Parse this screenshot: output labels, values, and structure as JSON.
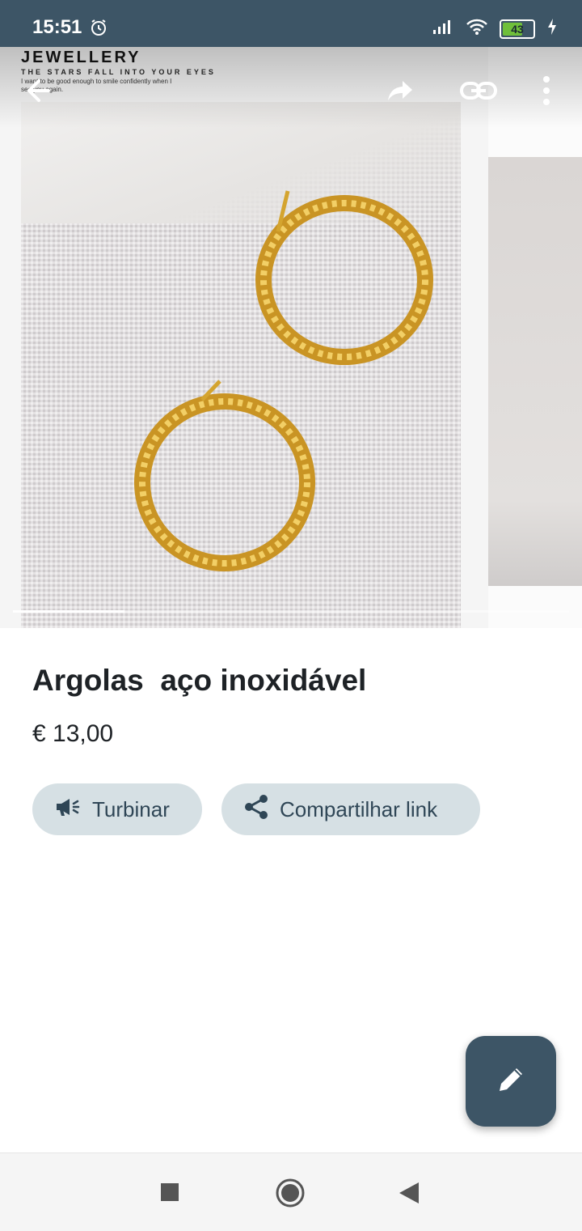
{
  "status": {
    "time": "15:51",
    "battery": "43"
  },
  "banner": {
    "logo": "JEWELLERY",
    "tagline": "THE STARS FALL INTO YOUR EYES",
    "note": "I want to be good enough to smile confidently when I see you again."
  },
  "gallery": {
    "slide_count": 5,
    "current_index": 1
  },
  "product": {
    "title": "Argolas  aço inoxidável",
    "price": "€ 13,00"
  },
  "actions": {
    "boost_label": "Turbinar",
    "share_label": "Compartilhar link"
  },
  "colors": {
    "primary": "#3d5566",
    "chip_bg": "#d6e0e4",
    "chip_text": "#2f4656",
    "gold": "#d9a92f"
  }
}
